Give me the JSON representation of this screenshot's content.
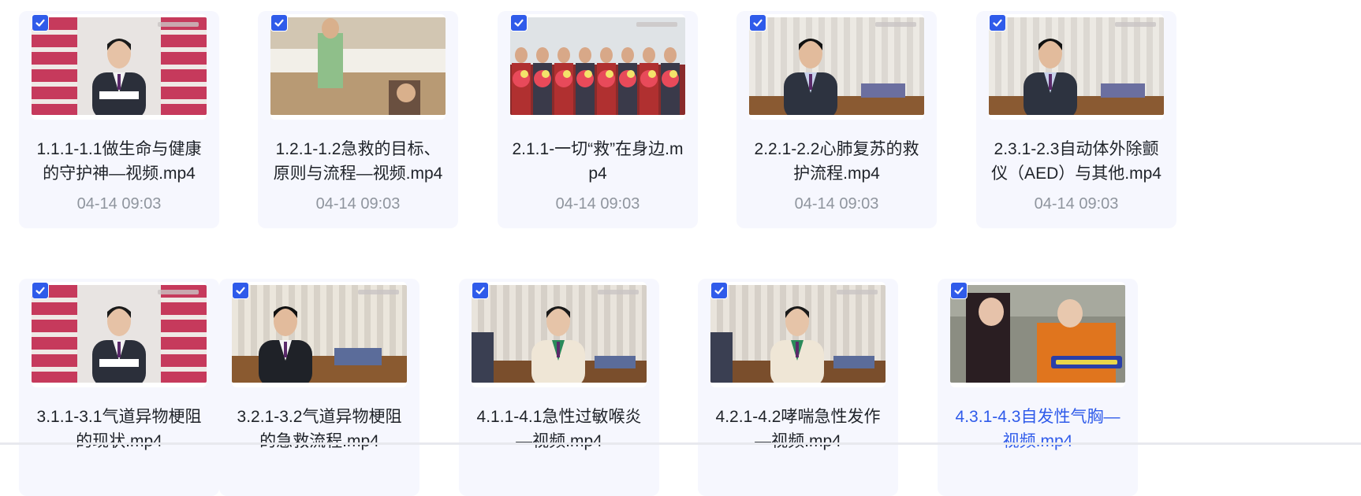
{
  "files": [
    {
      "title": "1.1.1-1.1做生命与健康的守护神—视频.mp4",
      "date": "04-14 09:03",
      "checked": true,
      "active": false,
      "thumbnail": "presenter-bookshelf"
    },
    {
      "title": "1.2.1-1.2急救的目标、原则与流程—视频.mp4",
      "date": "04-14 09:03",
      "checked": true,
      "active": false,
      "thumbnail": "dormitory-scene"
    },
    {
      "title": "2.1.1-一切“救”在身边.mp4",
      "date": "04-14 09:03",
      "checked": true,
      "active": false,
      "thumbnail": "group-with-flowers"
    },
    {
      "title": "2.2.1-2.2心肺复苏的救护流程.mp4",
      "date": "04-14 09:03",
      "checked": true,
      "active": false,
      "thumbnail": "presenter-studio"
    },
    {
      "title": "2.3.1-2.3自动体外除颤仪（AED）与其他.mp4",
      "date": "04-14 09:03",
      "checked": true,
      "active": false,
      "thumbnail": "presenter-studio"
    },
    {
      "title": "3.1.1-3.1气道异物梗阻的现状.mp4",
      "date": "",
      "checked": true,
      "active": false,
      "thumbnail": "presenter-bookshelf"
    },
    {
      "title": "3.2.1-3.2气道异物梗阻的急救流程.mp4",
      "date": "",
      "checked": true,
      "active": false,
      "thumbnail": "presenter-table"
    },
    {
      "title": "4.1.1-4.1急性过敏喉炎—视频.mp4",
      "date": "",
      "checked": true,
      "active": false,
      "thumbnail": "woman-presenter"
    },
    {
      "title": "4.2.1-4.2哮喘急性发作—视频.mp4",
      "date": "",
      "checked": true,
      "active": false,
      "thumbnail": "woman-presenter"
    },
    {
      "title": "4.3.1-4.3自发性气胸—视频.mp4",
      "date": "",
      "checked": true,
      "active": true,
      "thumbnail": "first-aid-scene"
    }
  ],
  "colors": {
    "accent": "#2f5bea",
    "card_bg": "#f6f7fe",
    "title": "#1f2329",
    "date": "#8f959e"
  }
}
